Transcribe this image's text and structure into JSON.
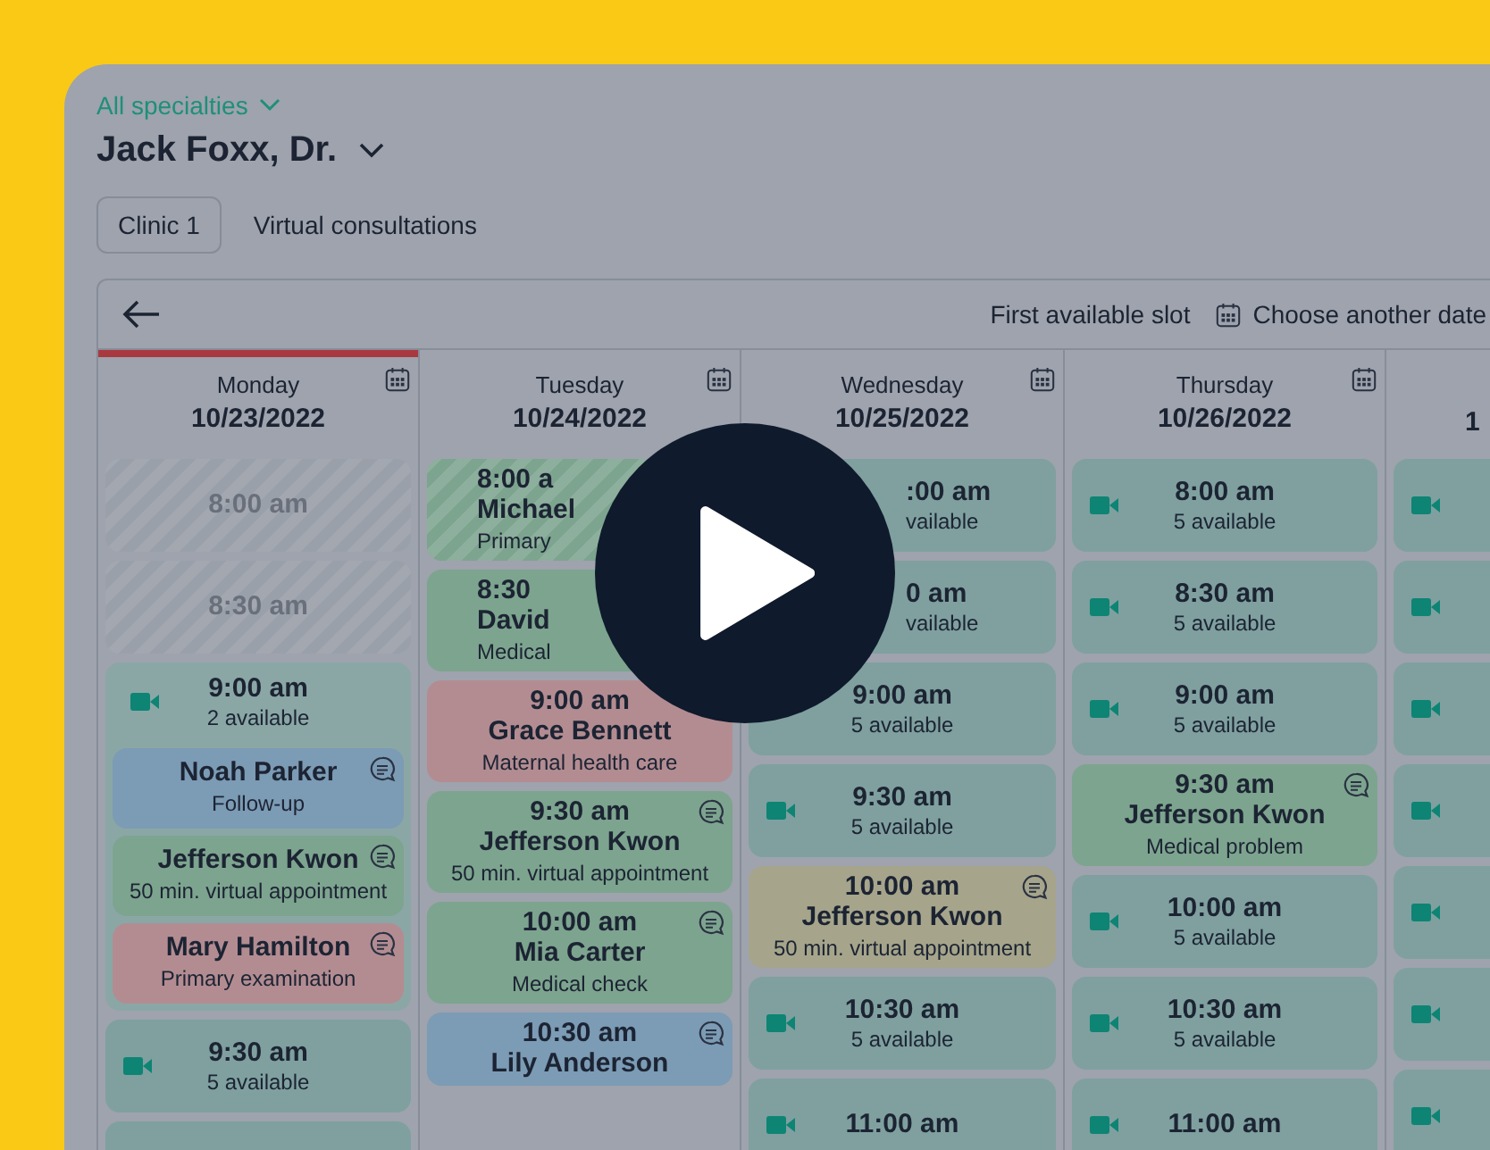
{
  "filter": {
    "label": "All specialties"
  },
  "doctor": {
    "name": "Jack Foxx, Dr."
  },
  "tabs": [
    {
      "label": "Clinic 1",
      "selected": true
    },
    {
      "label": "Virtual consultations",
      "selected": false
    }
  ],
  "toolbar": {
    "first_available": "First available slot",
    "choose_date": "Choose another date"
  },
  "days": [
    {
      "day": "Monday",
      "date": "10/23/2022",
      "today": true,
      "slots": [
        {
          "kind": "unavailable",
          "time": "8:00 am"
        },
        {
          "kind": "unavailable",
          "time": "8:30 am"
        },
        {
          "kind": "group",
          "time": "9:00 am",
          "count": "2 available",
          "video": true,
          "children": [
            {
              "kind": "appointment",
              "name": "Noah Parker",
              "reason": "Follow-up",
              "color": "#7c9bb5",
              "note": true,
              "past": false
            },
            {
              "kind": "appointment",
              "name": "Jefferson Kwon",
              "reason": "50 min. virtual appointment",
              "color": "#7da48f",
              "note": true,
              "past": false
            },
            {
              "kind": "appointment",
              "name": "Mary Hamilton",
              "reason": "Primary examination",
              "color": "#b38c92",
              "note": true,
              "past": false
            }
          ]
        },
        {
          "kind": "available",
          "time": "9:30 am",
          "count": "5 available",
          "video": true
        },
        {
          "kind": "blank"
        }
      ]
    },
    {
      "day": "Tuesday",
      "date": "10/24/2022",
      "today": false,
      "slots": [
        {
          "kind": "appointment",
          "time": "8:00 a",
          "name": "Michael",
          "reason": "Primary",
          "color": "#7da48f",
          "past": true,
          "partly_hidden": true
        },
        {
          "kind": "appointment",
          "time": "8:30",
          "name": "David",
          "reason": "Medical",
          "color": "#7da48f",
          "past": false,
          "partly_hidden": true
        },
        {
          "kind": "appointment",
          "time": "9:00 am",
          "name": "Grace Bennett",
          "reason": "Maternal health care",
          "color": "#b38c92",
          "past": false
        },
        {
          "kind": "appointment",
          "time": "9:30 am",
          "name": "Jefferson Kwon",
          "reason": "50 min. virtual appointment",
          "color": "#7da48f",
          "note": true,
          "past": false
        },
        {
          "kind": "appointment",
          "time": "10:00 am",
          "name": "Mia Carter",
          "reason": "Medical check",
          "color": "#7da48f",
          "note": true,
          "past": false
        },
        {
          "kind": "appointment",
          "time": "10:30 am",
          "name": "Lily Anderson",
          "color": "#7c9bb5",
          "note": true,
          "past": false
        }
      ]
    },
    {
      "day": "Wednesday",
      "date": "10/25/2022",
      "today": false,
      "slots": [
        {
          "kind": "available",
          "time": ":00 am",
          "count": "vailable",
          "video": false,
          "partly_hidden": true
        },
        {
          "kind": "available",
          "time": "0 am",
          "count": "vailable",
          "video": false,
          "partly_hidden": true
        },
        {
          "kind": "available",
          "time": "9:00 am",
          "count": "5 available",
          "video": false
        },
        {
          "kind": "available",
          "time": "9:30 am",
          "count": "5 available",
          "video": true
        },
        {
          "kind": "appointment",
          "time": "10:00 am",
          "name": "Jefferson Kwon",
          "reason": "50 min. virtual appointment",
          "color": "#a6a58b",
          "note": true,
          "past": false
        },
        {
          "kind": "available",
          "time": "10:30 am",
          "count": "5 available",
          "video": true
        },
        {
          "kind": "available",
          "time": "11:00 am",
          "video": true
        }
      ]
    },
    {
      "day": "Thursday",
      "date": "10/26/2022",
      "today": false,
      "slots": [
        {
          "kind": "available",
          "time": "8:00 am",
          "count": "5 available",
          "video": true
        },
        {
          "kind": "available",
          "time": "8:30 am",
          "count": "5 available",
          "video": true
        },
        {
          "kind": "available",
          "time": "9:00 am",
          "count": "5 available",
          "video": true
        },
        {
          "kind": "appointment",
          "time": "9:30 am",
          "name": "Jefferson Kwon",
          "reason": "Medical problem",
          "color": "#7da48f",
          "note": true,
          "past": false
        },
        {
          "kind": "available",
          "time": "10:00 am",
          "count": "5 available",
          "video": true
        },
        {
          "kind": "available",
          "time": "10:30 am",
          "count": "5 available",
          "video": true
        },
        {
          "kind": "available",
          "time": "11:00 am",
          "video": true
        }
      ]
    },
    {
      "date": "1",
      "today": false,
      "slots": [
        {
          "kind": "available",
          "video": true
        },
        {
          "kind": "available",
          "video": true
        },
        {
          "kind": "available",
          "video": true
        },
        {
          "kind": "available",
          "video": true
        },
        {
          "kind": "available",
          "video": true
        },
        {
          "kind": "available",
          "video": true
        },
        {
          "kind": "available",
          "video": true
        }
      ]
    }
  ]
}
